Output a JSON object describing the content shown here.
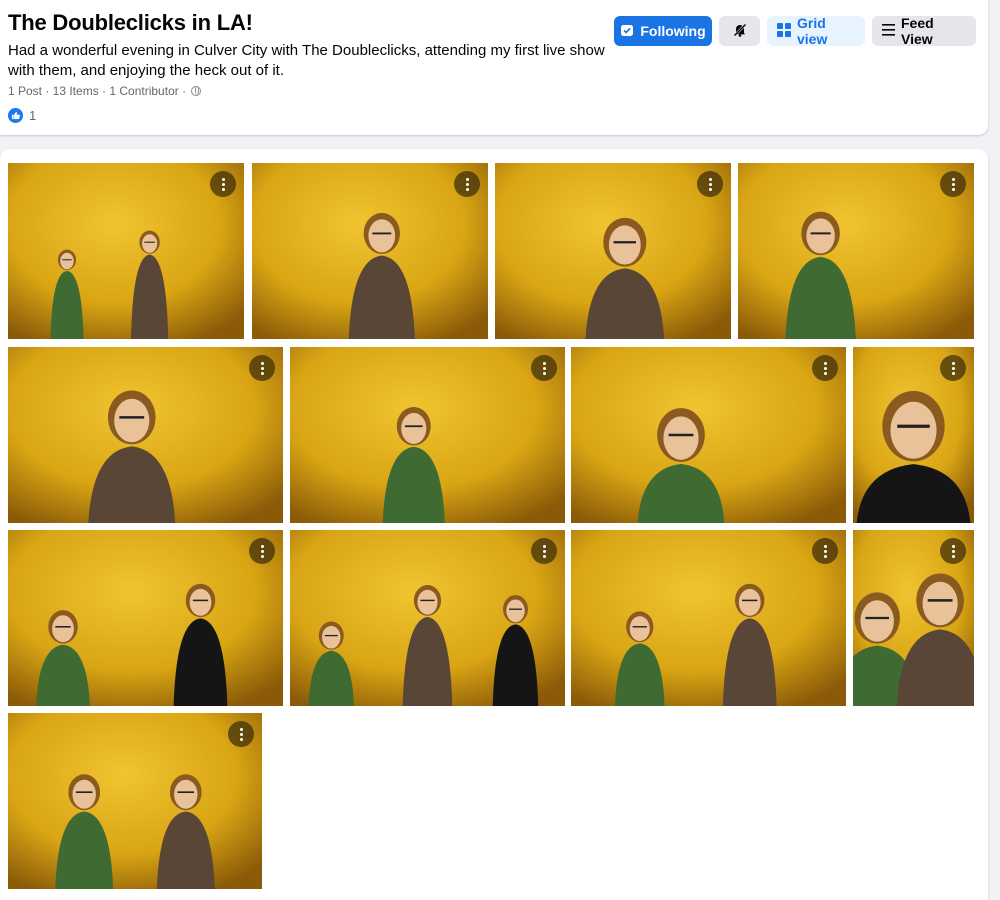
{
  "album": {
    "title": "The Doubleclicks in LA!",
    "description": "Had a wonderful evening in Culver City with The Doubleclicks, attending my first live show with them, and enjoying the heck out of it.",
    "meta": "1 Post · 13 Items · 1 Contributor ·",
    "privacy_icon": "globe-icon",
    "reaction_icon": "like-icon",
    "reaction_count": "1"
  },
  "actions": {
    "following_label": "Following",
    "following_icon": "calendar-check-icon",
    "mute_icon": "bell-off-icon",
    "grid_label": "Grid view",
    "grid_icon": "grid-icon",
    "feed_label": "Feed View",
    "feed_icon": "list-icon"
  },
  "colors": {
    "accent": "#1b74e4",
    "wall": "#d9a514",
    "wall_dark": "#8a5a08"
  },
  "photos": [
    {
      "subject": "duo-wide-stage"
    },
    {
      "subject": "singer-ukulele"
    },
    {
      "subject": "singer-closeup-mic"
    },
    {
      "subject": "cellist-music-stand"
    },
    {
      "subject": "singer-closeup-portrait"
    },
    {
      "subject": "cellist-playing"
    },
    {
      "subject": "cellist-profile-closeup"
    },
    {
      "subject": "guitarist-standing"
    },
    {
      "subject": "cellist-and-guitarist"
    },
    {
      "subject": "trio-with-guitarist"
    },
    {
      "subject": "cellist-and-singer"
    },
    {
      "subject": "duo-side-angle"
    },
    {
      "subject": "duo-singing-laughing"
    }
  ]
}
